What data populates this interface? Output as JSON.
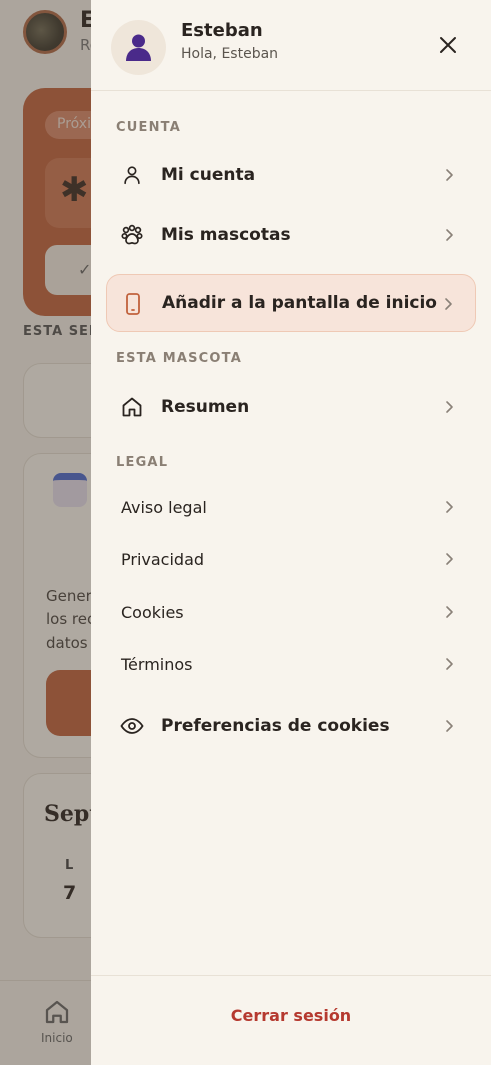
{
  "background": {
    "user_initial": "E",
    "user_sub": "Ro",
    "chip": "Próxi",
    "section_week": "ESTA SEM",
    "card_text": [
      "Gener",
      "los rec",
      "datos"
    ],
    "month": "Sept",
    "day_label": "L",
    "day_number": "7",
    "nav_home": "Inicio"
  },
  "drawer": {
    "user": {
      "name": "Esteban",
      "greeting": "Hola, Esteban"
    },
    "sections": {
      "cuenta": "CUENTA",
      "mascota": "ESTA MASCOTA",
      "legal": "LEGAL"
    },
    "cuenta_items": [
      {
        "label": "Mi cuenta",
        "icon": "person-icon"
      },
      {
        "label": "Mis mascotas",
        "icon": "paw-icon"
      },
      {
        "label": "Añadir a la pantalla de inicio",
        "icon": "phone-icon"
      }
    ],
    "mascota_items": [
      {
        "label": "Resumen",
        "icon": "home-icon"
      }
    ],
    "legal_items": [
      {
        "label": "Aviso legal"
      },
      {
        "label": "Privacidad"
      },
      {
        "label": "Cookies"
      },
      {
        "label": "Términos"
      }
    ],
    "cookie_prefs": {
      "label": "Preferencias de cookies",
      "icon": "eye-icon"
    },
    "logout": "Cerrar sesión"
  },
  "colors": {
    "accent": "#c1623d",
    "logout": "#b5392f",
    "highlight_bg": "#f7e4da",
    "avatar_figure": "#4a2a8a"
  }
}
